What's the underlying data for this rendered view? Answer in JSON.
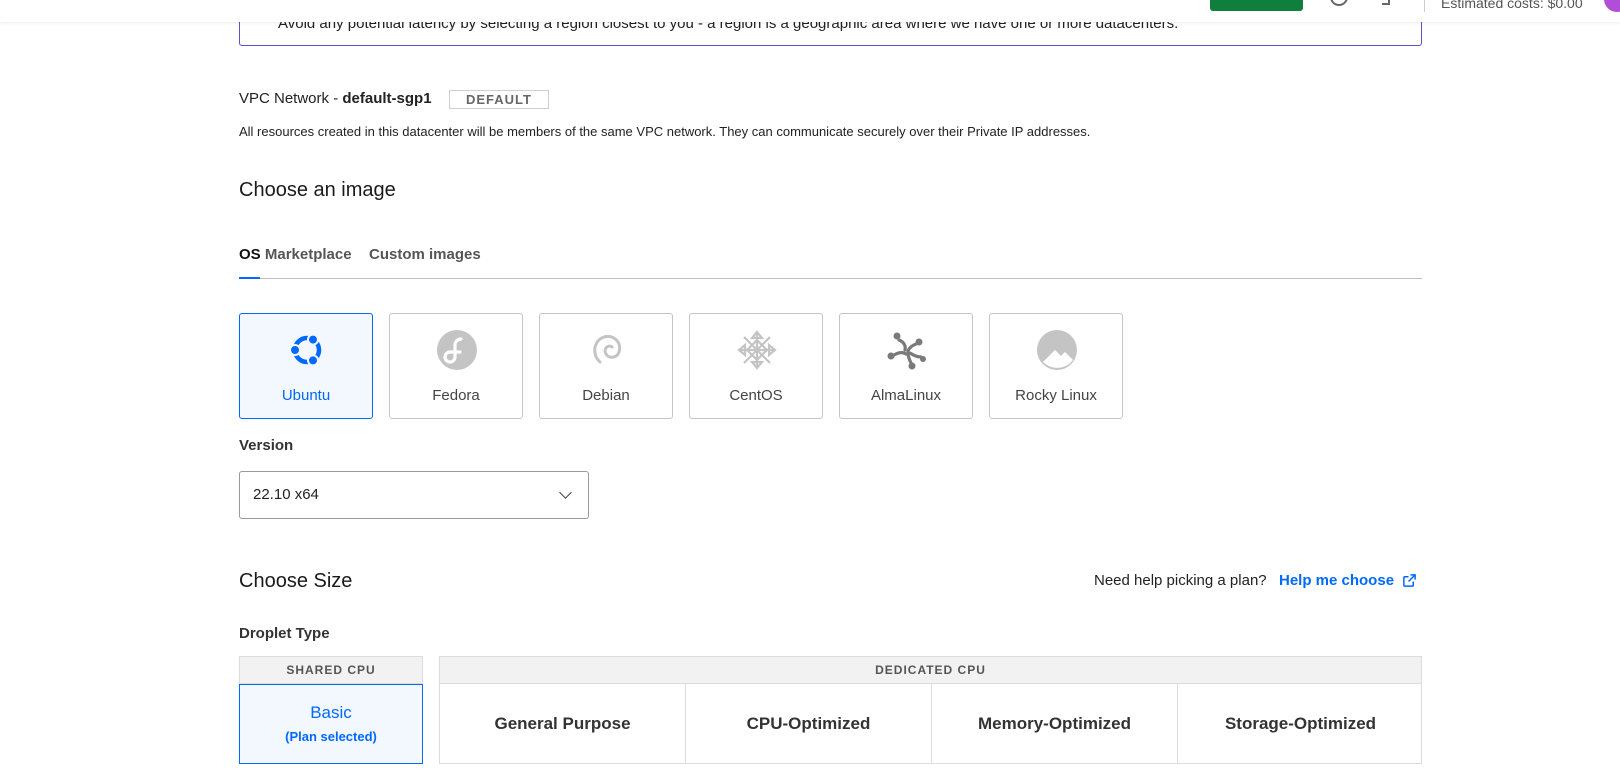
{
  "header": {
    "estimated_costs": "Estimated costs: $0.00"
  },
  "region": {
    "banner_text": "Avoid any potential latency by selecting a region closest to you - a region is a geographic area where we have one or more datacenters."
  },
  "vpc": {
    "prefix": "VPC Network - ",
    "name": "default-sgp1",
    "badge": "DEFAULT",
    "description": "All resources created in this datacenter will be members of the same VPC network. They can communicate securely over their Private IP addresses."
  },
  "image": {
    "title": "Choose an image",
    "tabs": [
      {
        "label": "OS"
      },
      {
        "label": "Marketplace"
      },
      {
        "label": "Custom images"
      }
    ],
    "os_options": [
      {
        "label": "Ubuntu",
        "icon": "ubuntu-icon",
        "color": "#0069ff",
        "selected": true
      },
      {
        "label": "Fedora",
        "icon": "fedora-icon",
        "color": "#bdbdbd"
      },
      {
        "label": "Debian",
        "icon": "debian-icon",
        "color": "#bdbdbd"
      },
      {
        "label": "CentOS",
        "icon": "centos-icon",
        "color": "#bdbdbd"
      },
      {
        "label": "AlmaLinux",
        "icon": "almalinux-icon",
        "color": "#777777"
      },
      {
        "label": "Rocky Linux",
        "icon": "rocky-linux-icon",
        "color": "#bdbdbd"
      }
    ],
    "version_label": "Version",
    "version_value": "22.10 x64"
  },
  "size": {
    "title": "Choose Size",
    "help_text": "Need help picking a plan?",
    "help_link": "Help me choose",
    "droplet_type_label": "Droplet Type",
    "shared_header": "SHARED CPU",
    "dedicated_header": "DEDICATED CPU",
    "basic_label": "Basic",
    "basic_status": "(Plan selected)",
    "dedicated_options": [
      {
        "label": "General Purpose"
      },
      {
        "label": "CPU-Optimized"
      },
      {
        "label": "Memory-Optimized"
      },
      {
        "label": "Storage-Optimized"
      }
    ]
  },
  "colors": {
    "accent": "#0069ff",
    "create_button": "#0f7f3d",
    "region_border": "#5b51c8"
  }
}
